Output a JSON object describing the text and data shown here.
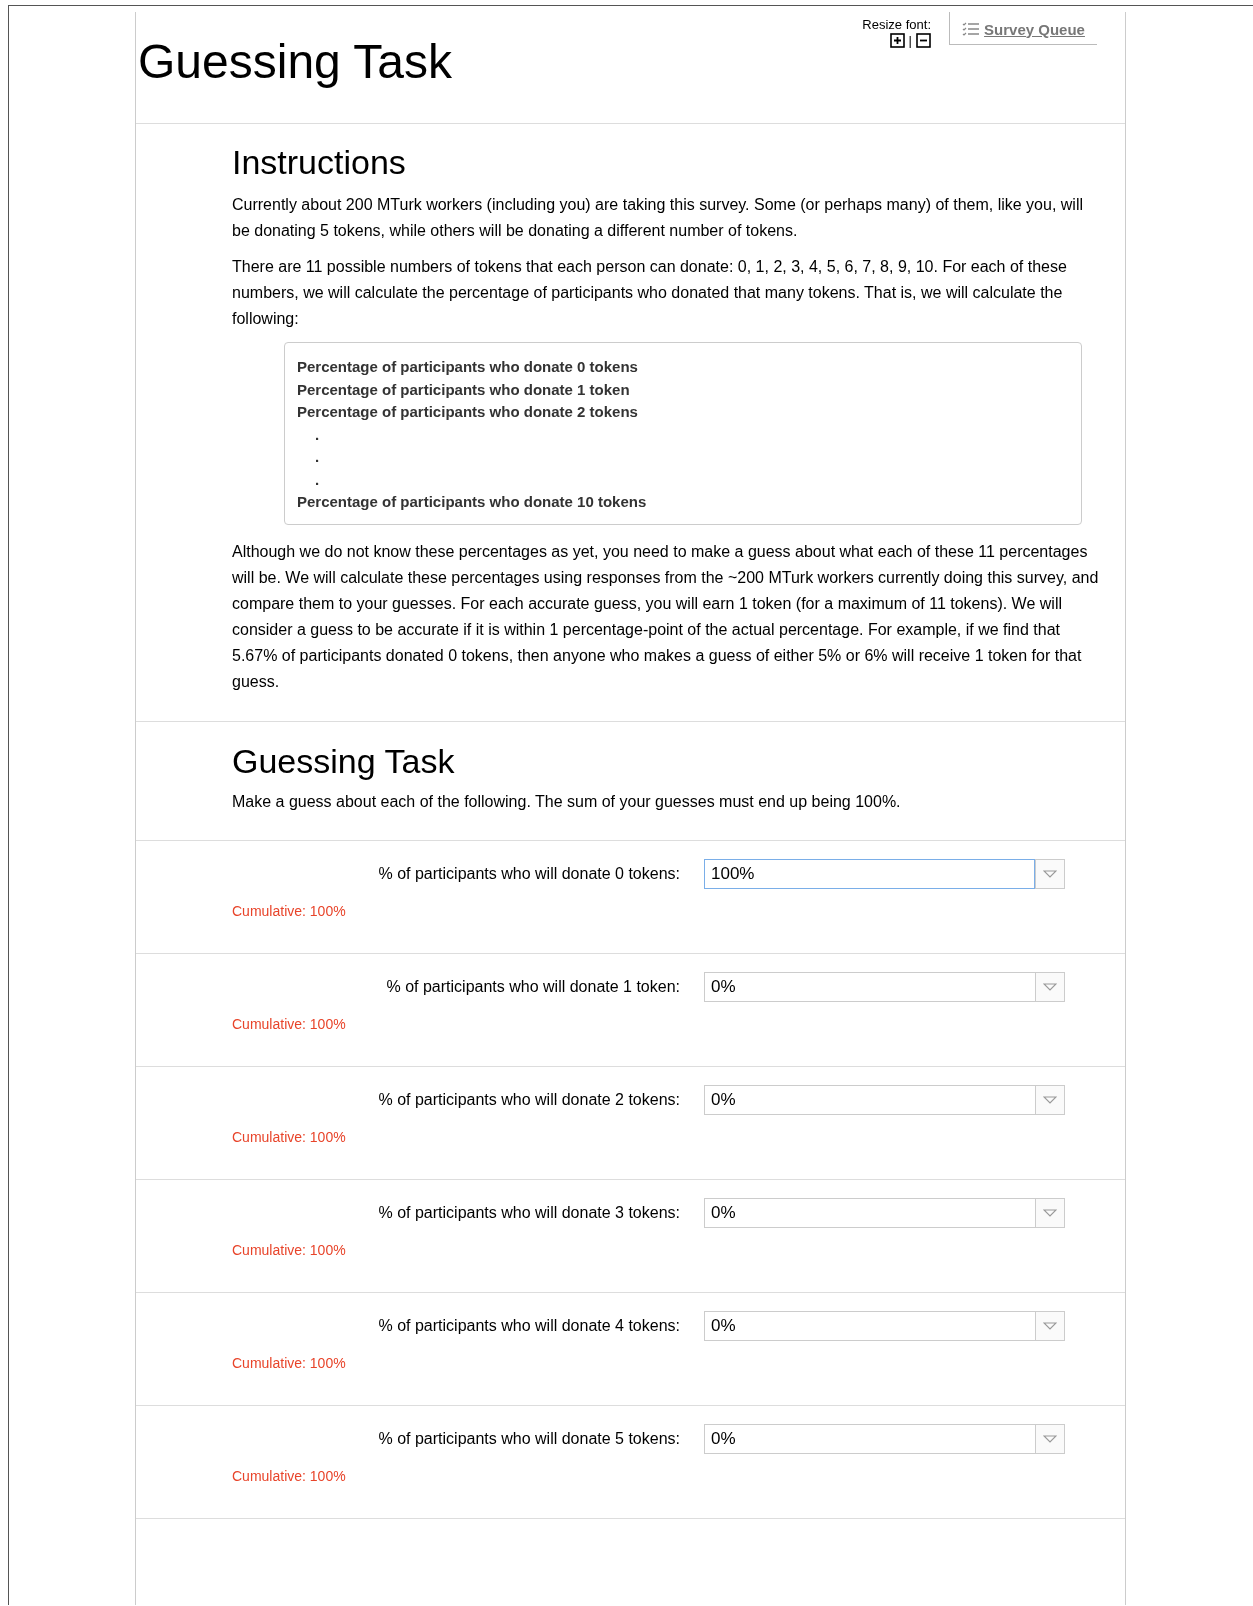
{
  "header": {
    "title": "Guessing Task",
    "resize_label": "Resize font:",
    "resize_separator": "|",
    "queue_link": "Survey Queue"
  },
  "instructions": {
    "heading": "Instructions",
    "paragraphs_before": [
      "Currently about 200 MTurk workers (including you) are taking this survey. Some (or perhaps many) of them, like you, will be donating 5 tokens, while others will be donating a different number of tokens.",
      "There are 11 possible numbers of tokens that each person can donate: 0, 1, 2, 3, 4, 5, 6, 7, 8, 9, 10. For each of these numbers, we will calculate the percentage of participants who donated that many tokens. That is, we will calculate the following:"
    ],
    "box_lines": [
      {
        "kind": "line",
        "text": "Percentage of participants who donate 0 tokens"
      },
      {
        "kind": "line",
        "text": "Percentage of participants who donate 1 token"
      },
      {
        "kind": "line",
        "text": "Percentage of participants who donate 2 tokens"
      },
      {
        "kind": "dot",
        "text": "."
      },
      {
        "kind": "dot",
        "text": "."
      },
      {
        "kind": "dot",
        "text": "."
      },
      {
        "kind": "line",
        "text": "Percentage of participants who donate 10 tokens"
      }
    ],
    "paragraphs_after": [
      "Although we do not know these percentages as yet, you need to make a guess about what each of these 11 percentages will be. We will calculate these percentages using responses from the ~200 MTurk workers currently doing this survey, and compare them to your guesses. For each accurate guess, you will earn 1 token (for a maximum of 11 tokens). We will consider a guess to be accurate if it is within 1 percentage-point of the actual percentage. For example, if we find that 5.67% of participants donated 0 tokens, then anyone who makes a guess of either 5% or 6% will receive 1 token for that guess."
    ]
  },
  "task": {
    "heading": "Guessing Task",
    "text": "Make a guess about each of the following. The sum of your guesses must end up being 100%."
  },
  "questions": [
    {
      "label": "% of participants who will donate 0 tokens:",
      "value": "100%",
      "focused": true,
      "cumulative": "Cumulative: 100%"
    },
    {
      "label": "% of participants who will donate 1 token:",
      "value": "0%",
      "focused": false,
      "cumulative": "Cumulative: 100%"
    },
    {
      "label": "% of participants who will donate 2 tokens:",
      "value": "0%",
      "focused": false,
      "cumulative": "Cumulative: 100%"
    },
    {
      "label": "% of participants who will donate 3 tokens:",
      "value": "0%",
      "focused": false,
      "cumulative": "Cumulative: 100%"
    },
    {
      "label": "% of participants who will donate 4 tokens:",
      "value": "0%",
      "focused": false,
      "cumulative": "Cumulative: 100%"
    },
    {
      "label": "% of participants who will donate 5 tokens:",
      "value": "0%",
      "focused": false,
      "cumulative": "Cumulative: 100%"
    }
  ]
}
